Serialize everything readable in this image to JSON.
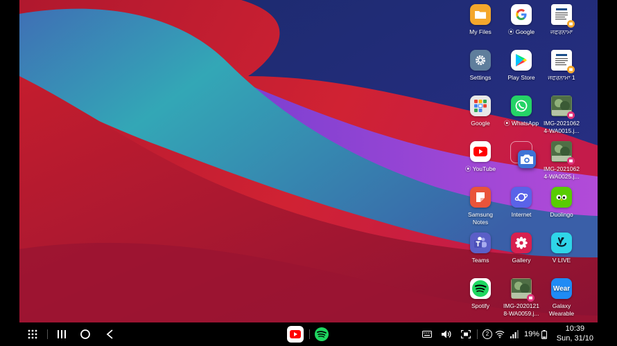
{
  "desktop_apps": [
    {
      "id": "my-files",
      "label": "My Files",
      "icon": "folder-icon",
      "color": "#f4a72c"
    },
    {
      "id": "google-chrome-shortcut",
      "label": "Google",
      "icon": "google-g-icon",
      "color": "#ffffff",
      "prefix_icon": true
    },
    {
      "id": "shortcut-1",
      "label": "ਜਫਰਨਾਮਾ",
      "icon": "document-thumbnail-icon",
      "color": "#ffffff",
      "badge": "#f4a72c"
    },
    {
      "id": "settings",
      "label": "Settings",
      "icon": "gear-icon",
      "color": "#5f7e9c"
    },
    {
      "id": "play-store",
      "label": "Play Store",
      "icon": "play-store-icon",
      "color": "#ffffff"
    },
    {
      "id": "shortcut-2",
      "label": "ਜਫਰਨਾਮਾ 1",
      "icon": "document-thumbnail-icon",
      "color": "#ffffff",
      "badge": "#f4a72c"
    },
    {
      "id": "google-folder",
      "label": "Google",
      "icon": "google-folder-icon",
      "color": "#e8e8e8"
    },
    {
      "id": "whatsapp",
      "label": "WhatsApp",
      "icon": "whatsapp-icon",
      "color": "#25d366",
      "prefix_icon": true
    },
    {
      "id": "img-1",
      "label": "IMG-2021062\n4-WA0015.j...",
      "icon": "photo-thumbnail-icon",
      "color": "#6b8d5b",
      "badge": "#e0337a"
    },
    {
      "id": "youtube",
      "label": "YouTube",
      "icon": "youtube-icon",
      "color": "#ffffff",
      "prefix_icon": true
    },
    {
      "id": "camera",
      "label": "",
      "icon": "camera-icon",
      "color": "#3e74d6",
      "dragging": true
    },
    {
      "id": "img-2",
      "label": "IMG-2021062\n4-WA0025.j...",
      "icon": "photo-thumbnail-icon",
      "color": "#557a48",
      "badge": "#e0337a"
    },
    {
      "id": "samsung-notes",
      "label": "Samsung\nNotes",
      "icon": "notes-icon",
      "color": "#e9543a"
    },
    {
      "id": "internet",
      "label": "Internet",
      "icon": "internet-planet-icon",
      "color": "#5a63e8"
    },
    {
      "id": "duolingo",
      "label": "Duolingo",
      "icon": "duolingo-owl-icon",
      "color": "#58cc02"
    },
    {
      "id": "teams",
      "label": "Teams",
      "icon": "teams-icon",
      "color": "#5b5fc7"
    },
    {
      "id": "gallery",
      "label": "Gallery",
      "icon": "gallery-flower-icon",
      "color": "#d8204f"
    },
    {
      "id": "vlive",
      "label": "V LIVE",
      "icon": "vlive-icon",
      "color": "#2fd6e8"
    },
    {
      "id": "spotify",
      "label": "Spotify",
      "icon": "spotify-icon",
      "color": "#1ed760"
    },
    {
      "id": "img-3",
      "label": "IMG-2020121\n8-WA0059.j...",
      "icon": "photo-thumbnail-icon",
      "color": "#a88a6e",
      "badge": "#e0337a"
    },
    {
      "id": "galaxy-wearable",
      "label": "Galaxy\nWearable",
      "icon": "wear-icon",
      "color": "#1f8bf5",
      "text": "Wear"
    }
  ],
  "taskbar": {
    "pinned_apps": [
      {
        "name": "youtube",
        "icon": "youtube-icon"
      },
      {
        "name": "spotify",
        "icon": "spotify-icon"
      }
    ],
    "status": {
      "notification_count": "2",
      "battery": "19%",
      "time": "10:39",
      "date": "Sun, 31/10"
    }
  }
}
